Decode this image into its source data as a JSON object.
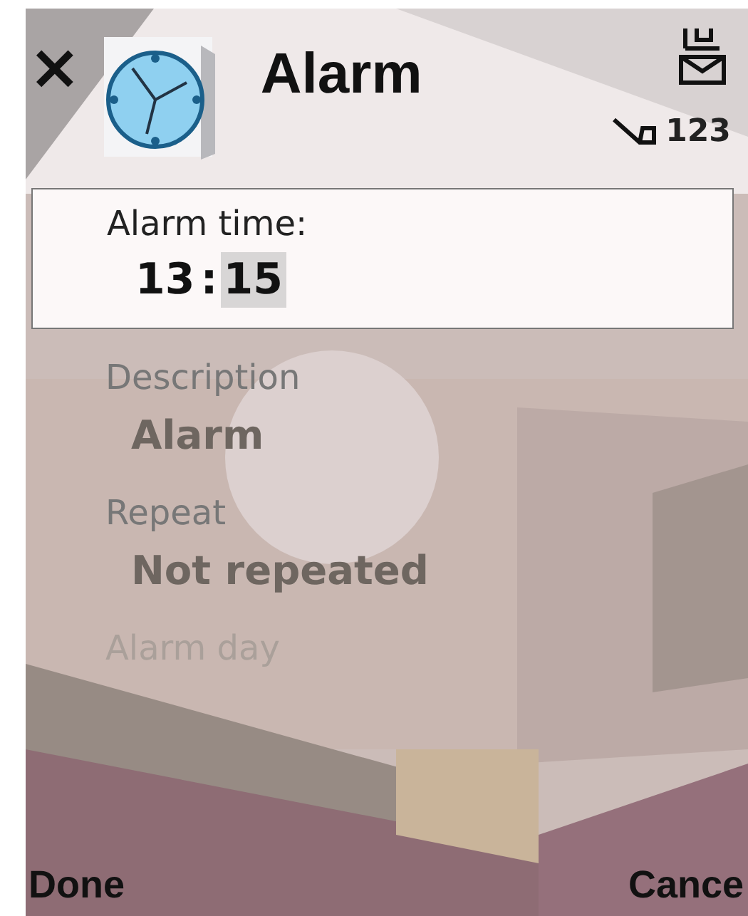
{
  "title_bar": {
    "close": "×",
    "title": "Alarm",
    "input_mode": "123"
  },
  "fields": [
    {
      "kind": "time",
      "label": "Alarm time:",
      "focused": true,
      "disabled": false,
      "separator": ":",
      "segments": [
        {
          "text": "13",
          "selected": false
        },
        {
          "text": "15",
          "selected": true
        }
      ]
    },
    {
      "kind": "text",
      "label": "Description",
      "value": "Alarm",
      "focused": false,
      "disabled": false
    },
    {
      "kind": "text",
      "label": "Repeat",
      "value": "Not repeated",
      "focused": false,
      "disabled": false
    },
    {
      "kind": "text",
      "label": "Alarm day",
      "focused": false,
      "disabled": true
    }
  ],
  "softkeys": {
    "left": "Done",
    "right": "Cance"
  }
}
